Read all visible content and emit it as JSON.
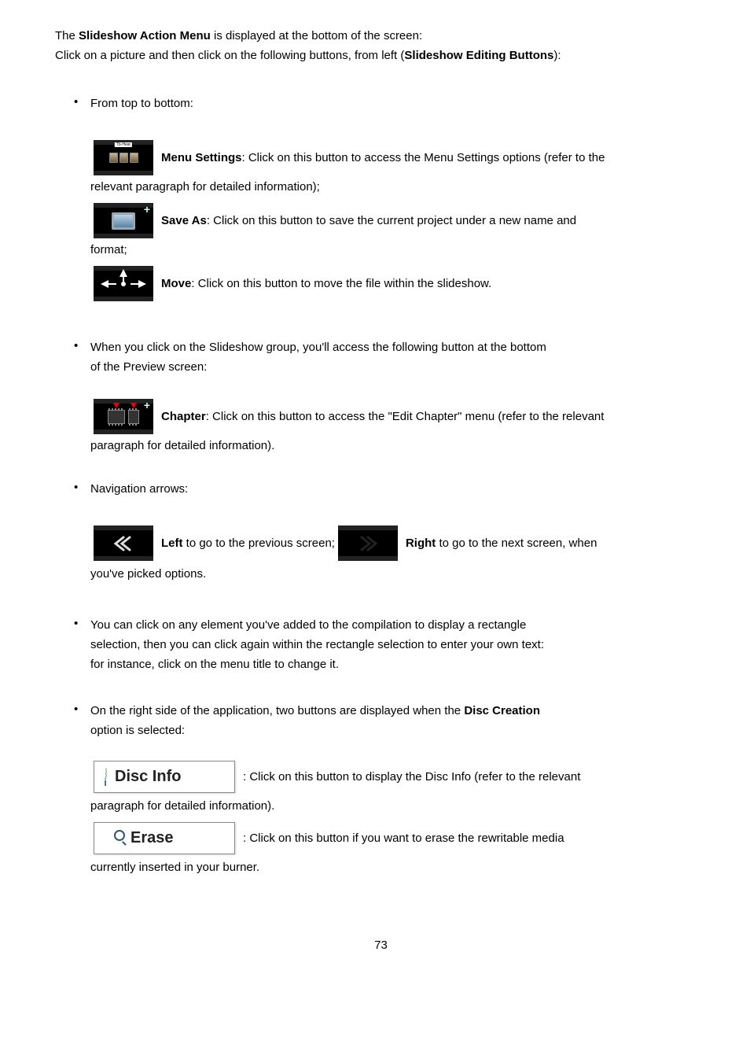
{
  "intro": {
    "line1_prefix": "The ",
    "line1_bold": "Slideshow Action Menu",
    "line1_suffix": " is displayed at the bottom of the screen:",
    "line2_prefix": "Click on a picture and then click on the following buttons, from left (",
    "line2_bold": "Slideshow Editing Buttons",
    "line2_suffix": "):"
  },
  "b1": {
    "lead": "From top to bottom:",
    "m1_bold": "Menu Settings",
    "m1_rest": ": Click on this button to access the Menu Settings options (refer to the",
    "m1_line2": "relevant paragraph for detailed information);",
    "m2_bold": "Save As",
    "m2_rest": ": Click on this button to save the current project under a new name and",
    "m2_line2": "format;",
    "m3_bold": "Move",
    "m3_rest": ": Click on this button to move the file within the slideshow."
  },
  "b2": {
    "lead": "When you click on the Slideshow group, you'll access the following button at the bottom",
    "lead2": "of the Preview screen:",
    "ch_bold": "Chapter",
    "ch_rest": ": Click on this button to access the \"Edit Chapter\" menu (refer to the relevant",
    "ch_line2": "paragraph for detailed information)."
  },
  "b3": {
    "lead": "Navigation arrows:",
    "left_bold": "Left",
    "left_rest": " to go to the previous screen; ",
    "right_bold": "Right",
    "right_rest": " to go to the next screen, when",
    "line2": "you've picked options."
  },
  "b4": {
    "p1": "You can click on any element you've added to the compilation to display a rectangle",
    "p2": "selection, then you can click again within the rectangle selection to enter your own text:",
    "p3": "for instance, click on the menu title to change it."
  },
  "b5": {
    "intro_prefix": "On the right side of the application, two buttons are displayed when the ",
    "intro_bold": "Disc Creation",
    "intro_suffix": "",
    "intro_line2": "option is selected:",
    "btn1_label": "Disc Info",
    "btn1_desc": ": Click on this button to display the Disc Info (refer to the relevant",
    "btn1_line2": "paragraph for detailed information).",
    "btn2_label": "Erase",
    "btn2_desc": ": Click on this button if you want to erase the rewritable media",
    "btn2_line2": "currently inserted in your burner."
  },
  "page_number": "73"
}
